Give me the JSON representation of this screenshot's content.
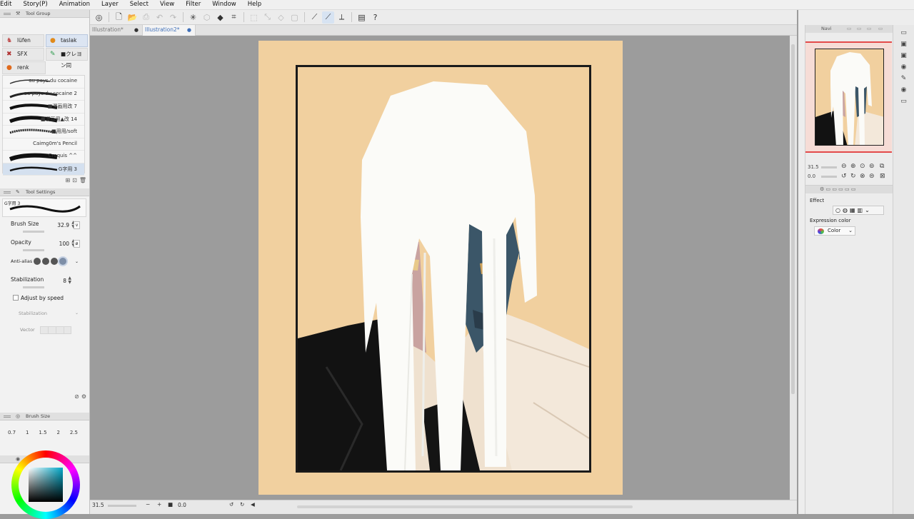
{
  "menu": {
    "items": [
      "Edit",
      "Story(P)",
      "Animation",
      "Layer",
      "Select",
      "View",
      "Filter",
      "Window",
      "Help"
    ]
  },
  "tabs": [
    {
      "label": "Illustration*",
      "active": false
    },
    {
      "label": "Illustration2*",
      "active": true
    }
  ],
  "tool_group": {
    "title": "Tool Group",
    "groups": [
      {
        "label": "lüfen",
        "icon": "ghost-icon"
      },
      {
        "label": "taslak",
        "icon": "smiley-icon",
        "selected": true
      },
      {
        "label": "SFX",
        "icon": "sfx-icon"
      },
      {
        "label": "■クレヨン同",
        "icon": "crayon-icon"
      },
      {
        "label": "renk",
        "icon": "palette-icon"
      }
    ]
  },
  "brushes": [
    {
      "label": "au pays du cocaine"
    },
    {
      "label": "au pays du cocaine 2"
    },
    {
      "label": "■漫画用改 7"
    },
    {
      "label": "■漫画用▲改 14"
    },
    {
      "label": "■用用/soft"
    },
    {
      "label": "Caimg0m's Pencil"
    },
    {
      "label": "Croquis ^^"
    },
    {
      "label": "G字用 3",
      "selected": true
    }
  ],
  "tool_settings": {
    "title": "Tool Settings",
    "preview_label": "G字用 3",
    "brush_size_label": "Brush Size",
    "brush_size_value": "32.9",
    "opacity_label": "Opacity",
    "opacity_value": "100",
    "antialias_label": "Anti-alias",
    "stabilization_label": "Stabilization",
    "stabilization_value": "8",
    "adjust_speed_label": "Adjust by speed",
    "stabilization_method_label": "Stabilization",
    "vector_label": "Vector"
  },
  "brush_size_panel": {
    "title": "Brush Size",
    "presets": [
      "0.7",
      "1",
      "1.5",
      "2",
      "2.5"
    ]
  },
  "navigator": {
    "tab_label": "Navi",
    "zoom_value": "31.5",
    "rotation_value": "0.0"
  },
  "effect_panel": {
    "title": "Effect",
    "expression_label": "Expression color",
    "expression_value": "Color"
  },
  "status": {
    "zoom": "31.5",
    "rotation": "0.0"
  },
  "colors": {
    "paper": "#f1d09f",
    "accent": "#3f6fb8",
    "hair": "#fbfbf8",
    "shirt": "#f3e8da",
    "jacket": "#121212",
    "blue_skin": "#3b5668",
    "pale_skin": "#c9a3a0"
  }
}
